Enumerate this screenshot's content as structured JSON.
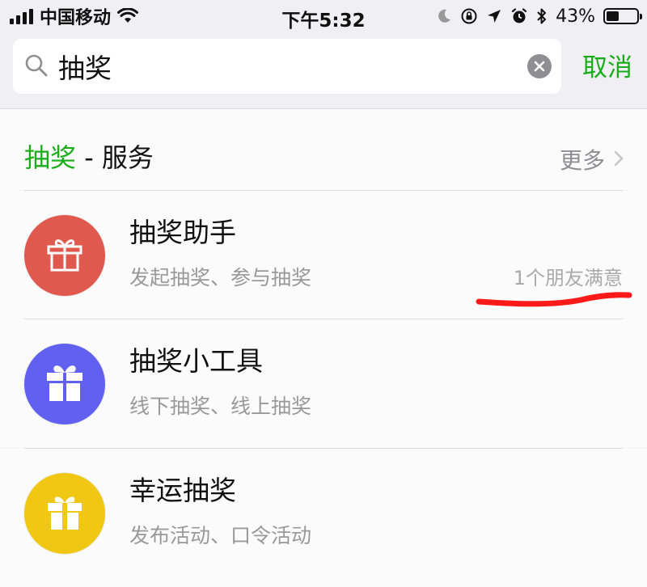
{
  "status_bar": {
    "carrier": "中国移动",
    "time": "下午5:32",
    "battery_percent": "43%",
    "battery_level": 0.43,
    "icons": [
      "signal-icon",
      "wifi-icon",
      "moon-icon",
      "orientation-lock-icon",
      "location-icon",
      "alarm-icon",
      "bluetooth-icon",
      "battery-icon"
    ]
  },
  "search": {
    "value": "抽奖",
    "cancel_label": "取消"
  },
  "section": {
    "keyword": "抽奖",
    "title_suffix": " - 服务",
    "more_label": "更多"
  },
  "results": [
    {
      "title": "抽奖助手",
      "subtitle": "发起抽奖、参与抽奖",
      "note": "1个朋友满意",
      "icon": "gift-icon",
      "color": "#e0594f"
    },
    {
      "title": "抽奖小工具",
      "subtitle": "线下抽奖、线上抽奖",
      "note": "",
      "icon": "gift-icon",
      "color": "#6160f0"
    },
    {
      "title": "幸运抽奖",
      "subtitle": "发布活动、口令活动",
      "note": "",
      "icon": "gift-icon",
      "color": "#f0c814"
    }
  ],
  "colors": {
    "accent": "#1aad19",
    "annotation": "#ff1a1a"
  }
}
